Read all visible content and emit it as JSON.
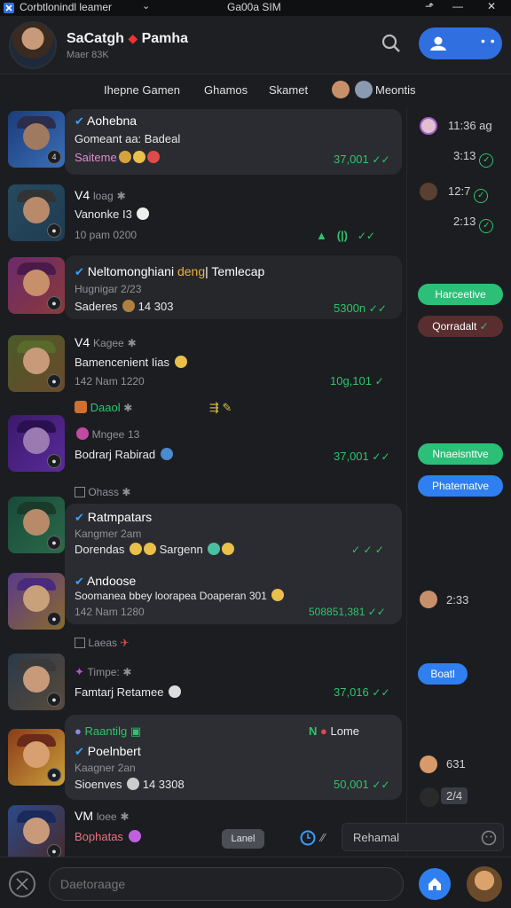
{
  "titlebar": {
    "title": "Corbtlonindl leamer",
    "caret": "⌄",
    "center": "Ga00a SIM",
    "controls": [
      "⬏",
      "—",
      "✕"
    ]
  },
  "header": {
    "title": "SaCatgh",
    "title_rest": "Pamha",
    "subtitle": "Maer 83K",
    "join_dots": "• •"
  },
  "tabs": [
    {
      "label": "Ihepne Gamen"
    },
    {
      "label": "Ghamos"
    },
    {
      "label": "Skamet"
    },
    {
      "label": "Meontis"
    }
  ],
  "rows": [
    {
      "title": "Aohebna",
      "line2": "Gomeant aa: Badeal",
      "line3": "Saiteme",
      "time": "37,001",
      "colors": [
        "#1c3b7a",
        "#3a6fb8"
      ]
    },
    {
      "title": "V4",
      "title_sub": "loag",
      "line2": "Vanonke I3",
      "line3": "10 pam 0200",
      "time": "",
      "colors": [
        "#274a5e",
        "#1f3c53"
      ]
    },
    {
      "title": "Neltomonghiani",
      "title_hl": "deng",
      "title_rest": "| Temlecap",
      "line2": "Hugnigar 2/23",
      "line3": "Saderes",
      "line3_val": "14 303",
      "time": "5300n",
      "colors": [
        "#6b2a6b",
        "#8a3a3a"
      ]
    },
    {
      "title": "V4",
      "title_sub": "Kagee",
      "line2": "Bamencenient Iias",
      "line3": "142 Nam 1220",
      "time": "10g,101",
      "colors": [
        "#4a5a2a",
        "#6a4a2a"
      ]
    },
    {
      "title": "Daaol",
      "title_sub": "",
      "line2": "",
      "line3": "",
      "time": "",
      "colors": []
    },
    {
      "title": "Mngee",
      "title_sub": "13",
      "line2": "Bodrarj Rabirad",
      "line3": "",
      "time": "37,001",
      "colors": [
        "#3a1a6a",
        "#5a2a9a"
      ]
    },
    {
      "title": "Ohass",
      "title_sub": "",
      "line2": "",
      "line3": "",
      "time": "",
      "colors": []
    },
    {
      "title": "Ratmpatars",
      "line2": "Kangmer 2am",
      "line3": "Dorendas",
      "line3_val": "Sargenn",
      "time": "",
      "colors": [
        "#1a4a3a",
        "#2a6a4a"
      ]
    },
    {
      "title": "Andoose",
      "line2": "Soomanea bbey loorapea Doaperan",
      "line2_val": "301",
      "line3": "142 Nam 1280",
      "time": "508851,381",
      "colors": [
        "#5a3a8a",
        "#8a6a2a"
      ]
    },
    {
      "title": "Laeas",
      "title_sub": "",
      "line2": "",
      "line3": "",
      "time": "",
      "colors": []
    },
    {
      "title": "Timpe:",
      "line2": "Famtarj Retamee",
      "line3": "",
      "time": "37,016",
      "colors": [
        "#2a3a4a",
        "#5a4a3a"
      ]
    },
    {
      "title": "Raantilg",
      "title2": "Poelnbert",
      "line2": "Kaagner 2an",
      "line3": "Sioenves",
      "line3_val": "14 3308",
      "time": "50,001",
      "right_label": "Lome",
      "colors": [
        "#8a3a1a",
        "#caa03a"
      ]
    },
    {
      "title": "VM",
      "title_sub": "loee",
      "line2": "Bophatas",
      "chip": "Lanel",
      "colors": [
        "#2a4a8a",
        "#4a2a2a"
      ]
    }
  ],
  "right_col": {
    "times": [
      "11:36 ag",
      "3:13",
      "12:7",
      "2:13",
      "2:33",
      "631",
      "2/4"
    ],
    "pills": [
      {
        "label": "Harceetive",
        "color": "#2bbf77"
      },
      {
        "label": "Qorradalt",
        "color": "#7a3a3a"
      },
      {
        "label": "Nnaeisnttve",
        "color": "#2bbf77"
      },
      {
        "label": "Phatematve",
        "color": "#2f7ff0"
      },
      {
        "label": "Boatl",
        "color": "#2f7ff0"
      }
    ]
  },
  "composer": {
    "placeholder": "Daetoraage",
    "mini_input": "Rehamal"
  },
  "colors": {
    "accent": "#2f6fe0",
    "online": "#2ec46a",
    "bg": "#1b1d21"
  }
}
